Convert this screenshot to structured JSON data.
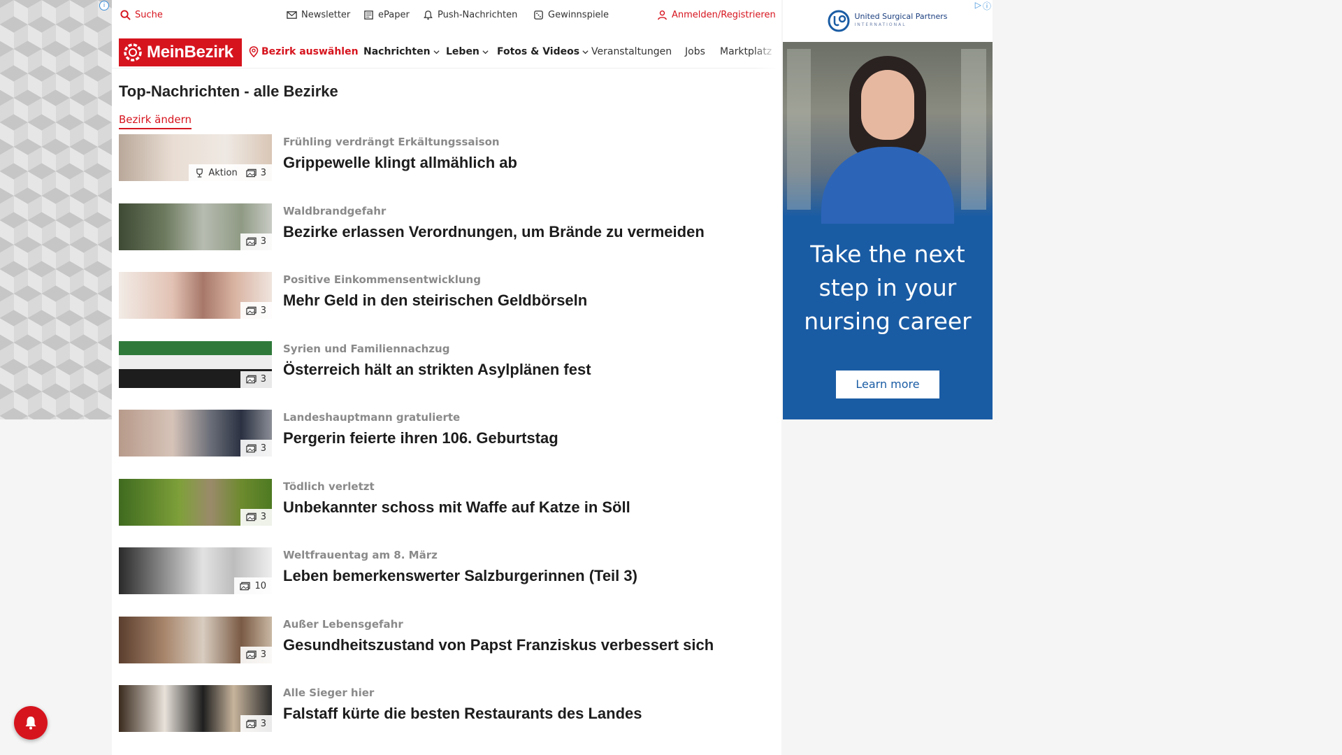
{
  "topbar": {
    "search": "Suche",
    "newsletter": "Newsletter",
    "epaper": "ePaper",
    "push": "Push-Nachrichten",
    "games": "Gewinnspiele",
    "login": "Anmelden/Registrieren"
  },
  "nav": {
    "logo": "MeinBezirk",
    "district": "Bezirk auswählen",
    "items": [
      "Nachrichten",
      "Leben",
      "Fotos & Videos",
      "Veranstaltungen",
      "Jobs",
      "Marktplatz"
    ]
  },
  "page": {
    "title": "Top-Nachrichten - alle Bezirke",
    "change_district": "Bezirk ändern"
  },
  "articles": [
    {
      "kicker": "Frühling verdrängt Erkältungssaison",
      "headline": "Grippewelle klingt allmählich ab",
      "count": "3",
      "aktion": "Aktion"
    },
    {
      "kicker": "Waldbrandgefahr",
      "headline": "Bezirke erlassen Verordnungen, um Brände zu vermeiden",
      "count": "3"
    },
    {
      "kicker": "Positive Einkommensentwicklung",
      "headline": "Mehr Geld in den steirischen Geldbörseln",
      "count": "3"
    },
    {
      "kicker": "Syrien und Familiennachzug",
      "headline": "Österreich hält an strikten Asylplänen fest",
      "count": "3"
    },
    {
      "kicker": "Landeshauptmann gratulierte",
      "headline": "Pergerin feierte ihren 106. Geburtstag",
      "count": "3"
    },
    {
      "kicker": "Tödlich verletzt",
      "headline": "Unbekannter schoss mit Waffe auf Katze in Söll",
      "count": "3"
    },
    {
      "kicker": "Weltfrauentag am 8. März",
      "headline": "Leben bemerkenswerter Salzburgerinnen (Teil 3)",
      "count": "10"
    },
    {
      "kicker": "Außer Lebensgefahr",
      "headline": "Gesundheitszustand von Papst Franziskus verbessert sich",
      "count": "3"
    },
    {
      "kicker": "Alle Sieger hier",
      "headline": "Falstaff kürte die besten Restaurants des Landes",
      "count": "3"
    }
  ],
  "ad": {
    "brand": "United Surgical Partners",
    "brand_sub": "INTERNATIONAL",
    "copy_lines": [
      "Take the next",
      "step in your",
      "nursing career"
    ],
    "cta": "Learn more"
  },
  "colors": {
    "brand_red": "#d6141e",
    "ad_blue": "#1a5ca4"
  }
}
